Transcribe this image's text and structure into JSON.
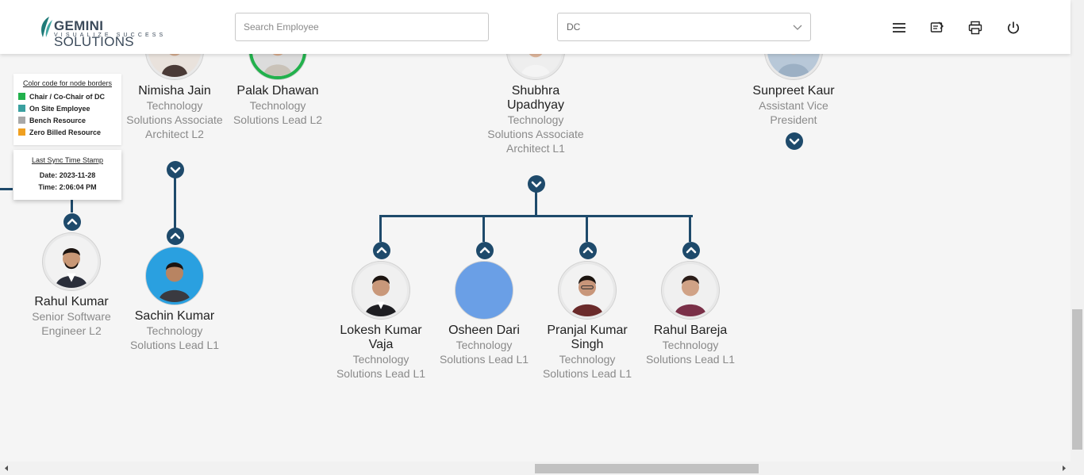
{
  "header": {
    "logo_main_bold": "GEMINI",
    "logo_main_rest": " SOLUTIONS",
    "logo_tagline": "VISUALIZE SUCCESS",
    "search_placeholder": "Search Employee",
    "dc_select_value": "DC",
    "icons": [
      "menu-icon",
      "feedback-icon",
      "print-icon",
      "power-icon"
    ]
  },
  "legend": {
    "title": "Color code for node borders",
    "items": [
      {
        "label": "Chair / Co-Chair of DC",
        "color": "#22b14c"
      },
      {
        "label": "On Site Employee",
        "color": "#3aa0a0"
      },
      {
        "label": "Bench Resource",
        "color": "#a8a8a8"
      },
      {
        "label": "Zero Billed Resource",
        "color": "#f0a020"
      }
    ]
  },
  "sync": {
    "title": "Last Sync Time Stamp",
    "date": "Date: 2023-11-28",
    "time": "Time: 2:06:04 PM"
  },
  "nodes": {
    "nimisha": {
      "name": "Nimisha Jain",
      "title": "Technology Solutions Associate Architect L2"
    },
    "palak": {
      "name": "Palak Dhawan",
      "title": "Technology Solutions Lead L2"
    },
    "shubhra": {
      "name": "Shubhra Upadhyay",
      "title": "Technology Solutions Associate Architect L1"
    },
    "sunpreet": {
      "name": "Sunpreet Kaur",
      "title": "Assistant Vice President"
    },
    "rahul_kumar": {
      "name": "Rahul Kumar",
      "title": "Senior Software Engineer L2"
    },
    "sachin": {
      "name": "Sachin Kumar",
      "title": "Technology Solutions Lead L1"
    },
    "lokesh": {
      "name": "Lokesh Kumar Vaja",
      "title": "Technology Solutions Lead L1"
    },
    "osheen": {
      "name": "Osheen Dari",
      "title": "Technology Solutions Lead L1"
    },
    "pranjal": {
      "name": "Pranjal Kumar Singh",
      "title": "Technology Solutions Lead L1"
    },
    "rahul_bareja": {
      "name": "Rahul Bareja",
      "title": "Technology Solutions Lead L1"
    }
  },
  "colors": {
    "accent": "#1e4a6b",
    "chair_border": "#22b14c",
    "sachin_bg": "#2aa0e0",
    "osheen_bg": "#6a9fe6"
  }
}
